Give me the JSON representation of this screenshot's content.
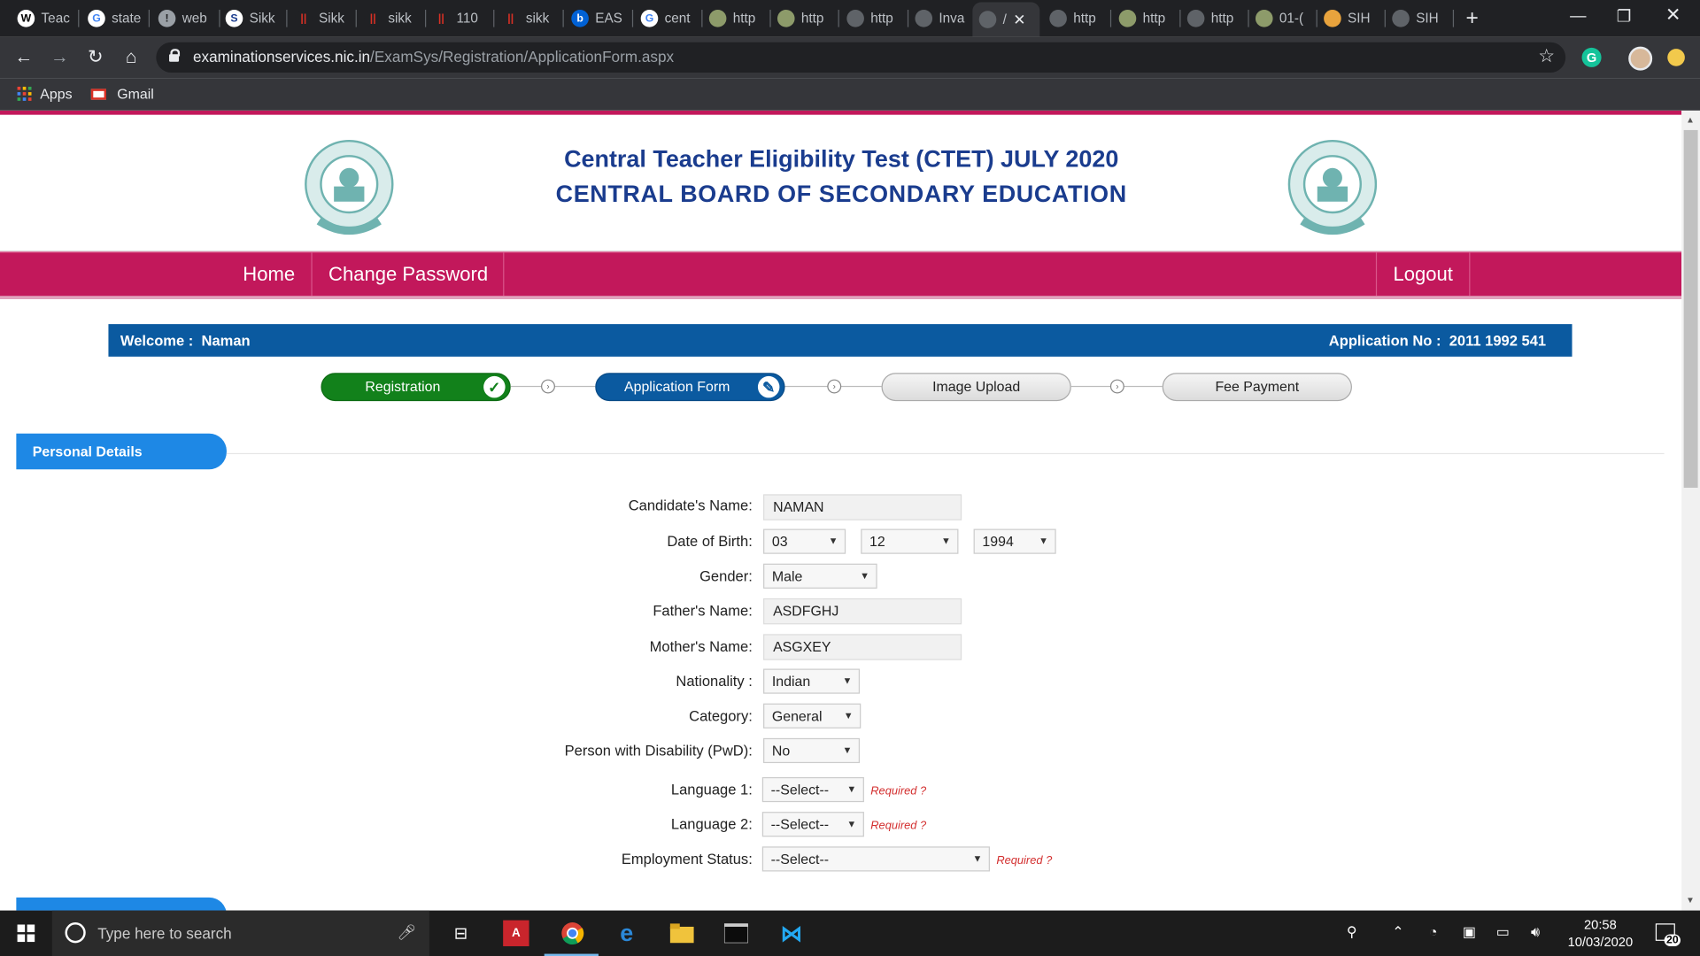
{
  "browser": {
    "tabs": [
      {
        "label": "Teac",
        "icon": "wikipedia-icon",
        "fav_text": "W",
        "fav_bg": "#ffffff",
        "fav_fg": "#000000"
      },
      {
        "label": "state",
        "icon": "google-icon",
        "fav_text": "G",
        "fav_bg": "#ffffff",
        "fav_fg": "#4285f4"
      },
      {
        "label": "web",
        "icon": "globe-icon",
        "fav_text": "!",
        "fav_bg": "#9aa0a6",
        "fav_fg": "#202124"
      },
      {
        "label": "Sikk",
        "icon": "sikkim-site-icon",
        "fav_text": "S",
        "fav_bg": "#ffffff",
        "fav_fg": "#1a3c8e"
      },
      {
        "label": "Sikk",
        "icon": "bookmark-red-icon",
        "fav_text": "||",
        "fav_bg": "#202124",
        "fav_fg": "#d93025"
      },
      {
        "label": "sikk",
        "icon": "bookmark-red-icon",
        "fav_text": "||",
        "fav_bg": "#202124",
        "fav_fg": "#d93025"
      },
      {
        "label": "110",
        "icon": "bookmark-red-icon",
        "fav_text": "||",
        "fav_bg": "#202124",
        "fav_fg": "#d93025"
      },
      {
        "label": "sikk",
        "icon": "bookmark-red-icon",
        "fav_text": "||",
        "fav_bg": "#202124",
        "fav_fg": "#d93025"
      },
      {
        "label": "EAS",
        "icon": "box-icon",
        "fav_text": "b",
        "fav_bg": "#0061d5",
        "fav_fg": "#ffffff"
      },
      {
        "label": "cent",
        "icon": "google-icon",
        "fav_text": "G",
        "fav_bg": "#ffffff",
        "fav_fg": "#4285f4"
      },
      {
        "label": "http",
        "icon": "cbse-icon",
        "fav_text": "",
        "fav_bg": "#8d9b6a",
        "fav_fg": "#ffffff"
      },
      {
        "label": "http",
        "icon": "cbse-icon",
        "fav_text": "",
        "fav_bg": "#8d9b6a",
        "fav_fg": "#ffffff"
      },
      {
        "label": "http",
        "icon": "globe-icon",
        "fav_text": "",
        "fav_bg": "#5f6368",
        "fav_fg": "#ffffff"
      },
      {
        "label": "Inva",
        "icon": "globe-icon",
        "fav_text": "",
        "fav_bg": "#5f6368",
        "fav_fg": "#ffffff"
      },
      {
        "label": "/",
        "icon": "globe-icon",
        "fav_text": "",
        "fav_bg": "#5f6368",
        "fav_fg": "#ffffff",
        "active": true
      },
      {
        "label": "http",
        "icon": "globe-icon",
        "fav_text": "",
        "fav_bg": "#5f6368",
        "fav_fg": "#ffffff"
      },
      {
        "label": "http",
        "icon": "cbse-icon",
        "fav_text": "",
        "fav_bg": "#8d9b6a",
        "fav_fg": "#ffffff"
      },
      {
        "label": "http",
        "icon": "globe-icon",
        "fav_text": "",
        "fav_bg": "#5f6368",
        "fav_fg": "#ffffff"
      },
      {
        "label": "01-(",
        "icon": "cbse-icon",
        "fav_text": "",
        "fav_bg": "#8d9b6a",
        "fav_fg": "#ffffff"
      },
      {
        "label": "SIH",
        "icon": "balloon-icon",
        "fav_text": "",
        "fav_bg": "#e8a33d",
        "fav_fg": "#ffffff"
      },
      {
        "label": "SIH",
        "icon": "globe-icon",
        "fav_text": "",
        "fav_bg": "#5f6368",
        "fav_fg": "#ffffff"
      }
    ],
    "url_host": "examinationservices.nic.in",
    "url_path": "/ExamSys/Registration/ApplicationForm.aspx",
    "bookmarks": {
      "apps": "Apps",
      "gmail": "Gmail"
    }
  },
  "header": {
    "title_line1": "Central Teacher Eligibility Test (CTET) JULY 2020",
    "title_line2": "CENTRAL BOARD OF SECONDARY EDUCATION"
  },
  "nav": {
    "home": "Home",
    "change_password": "Change Password",
    "logout": "Logout"
  },
  "welcome": {
    "label": "Welcome :",
    "name": "Naman",
    "app_label": "Application No :",
    "app_no": "2011 1992 541"
  },
  "steps": {
    "registration": "Registration",
    "application_form": "Application Form",
    "image_upload": "Image Upload",
    "fee_payment": "Fee Payment"
  },
  "section": {
    "personal_details": "Personal Details"
  },
  "form": {
    "candidate_name_label": "Candidate's Name:",
    "candidate_name": "NAMAN",
    "dob_label": "Date of Birth:",
    "dob_day": "03",
    "dob_month": "12",
    "dob_year": "1994",
    "gender_label": "Gender:",
    "gender": "Male",
    "father_label": "Father's Name:",
    "father": "ASDFGHJ",
    "mother_label": "Mother's Name:",
    "mother": "ASGXEY",
    "nationality_label": "Nationality :",
    "nationality": "Indian",
    "category_label": "Category:",
    "category": "General",
    "pwd_label": "Person with Disability (PwD):",
    "pwd": "No",
    "lang1_label": "Language 1:",
    "lang1": "--Select--",
    "lang2_label": "Language 2:",
    "lang2": "--Select--",
    "employment_label": "Employment Status:",
    "employment": "--Select--",
    "required": "Required ?"
  },
  "taskbar": {
    "search_placeholder": "Type here to search",
    "time": "20:58",
    "date": "10/03/2020",
    "notif_count": "20"
  },
  "colors": {
    "brand_magenta": "#c2185b",
    "brand_blue": "#0b5aa0",
    "step_done": "#12811b",
    "section_blue": "#1e88e5"
  }
}
